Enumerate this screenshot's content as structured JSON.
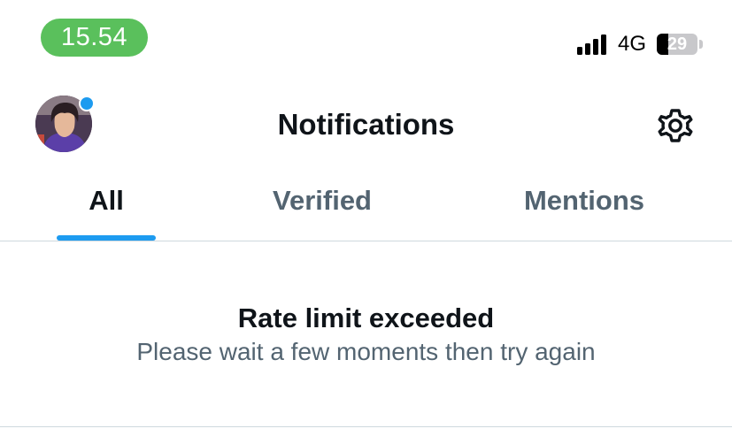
{
  "status_bar": {
    "time": "15.54",
    "network": "4G",
    "battery_level": "29",
    "battery_fraction": 0.29,
    "signal_icon": "cellular-signal-icon",
    "battery_icon": "battery-icon"
  },
  "header": {
    "title": "Notifications",
    "avatar_icon": "profile-avatar",
    "settings_icon": "gear-icon"
  },
  "tabs": [
    {
      "label": "All",
      "active": true
    },
    {
      "label": "Verified",
      "active": false
    },
    {
      "label": "Mentions",
      "active": false
    }
  ],
  "message": {
    "title": "Rate limit exceeded",
    "subtitle": "Please wait a few moments then try again"
  },
  "colors": {
    "accent": "#1d9bf0",
    "time_pill": "#5ac05c",
    "text_primary": "#0f1419",
    "text_secondary": "#536471",
    "divider": "#cfd9de"
  }
}
